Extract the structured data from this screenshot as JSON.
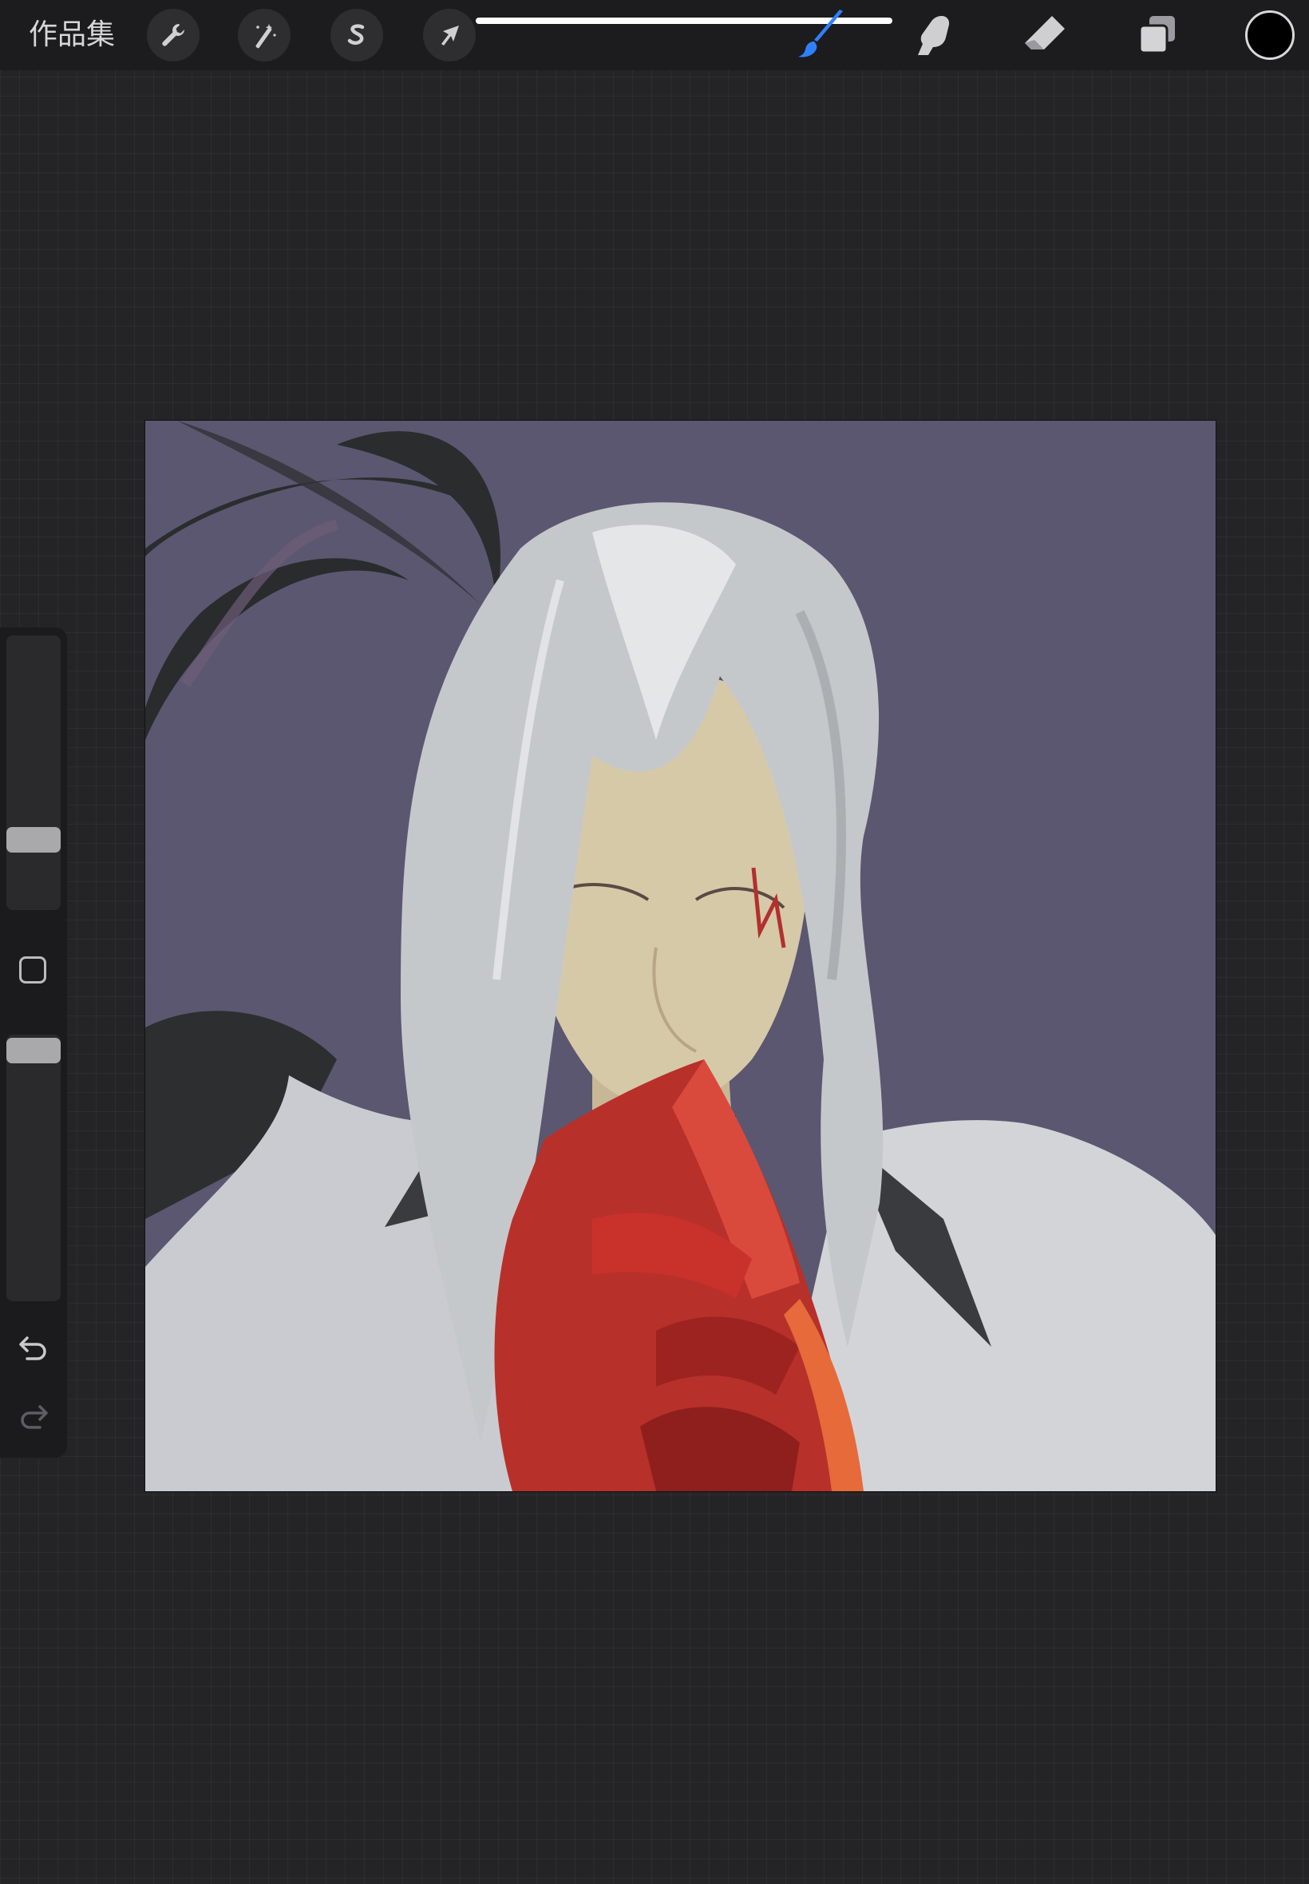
{
  "topbar": {
    "gallery_label": "作品集",
    "left_tools": [
      {
        "name": "actions",
        "icon": "wrench-icon"
      },
      {
        "name": "adjustments",
        "icon": "magic-wand-icon"
      },
      {
        "name": "selection",
        "icon": "selection-s-icon"
      },
      {
        "name": "transform",
        "icon": "arrow-cursor-icon"
      }
    ],
    "right_tools": [
      {
        "name": "brush",
        "icon": "brush-icon",
        "active": true,
        "accent": "#2f80ff"
      },
      {
        "name": "smudge",
        "icon": "smudge-finger-icon"
      },
      {
        "name": "eraser",
        "icon": "eraser-icon"
      },
      {
        "name": "layers",
        "icon": "layers-icon"
      }
    ],
    "current_color": "#000000"
  },
  "sidebar": {
    "brush_size_level": 0.25,
    "opacity_level": 1.0,
    "modify_icon": "square-icon",
    "undo_icon": "undo-icon",
    "redo_icon": "redo-icon"
  },
  "canvas": {
    "background_color": "#5b5770",
    "artwork": "digital-painting-icon"
  }
}
